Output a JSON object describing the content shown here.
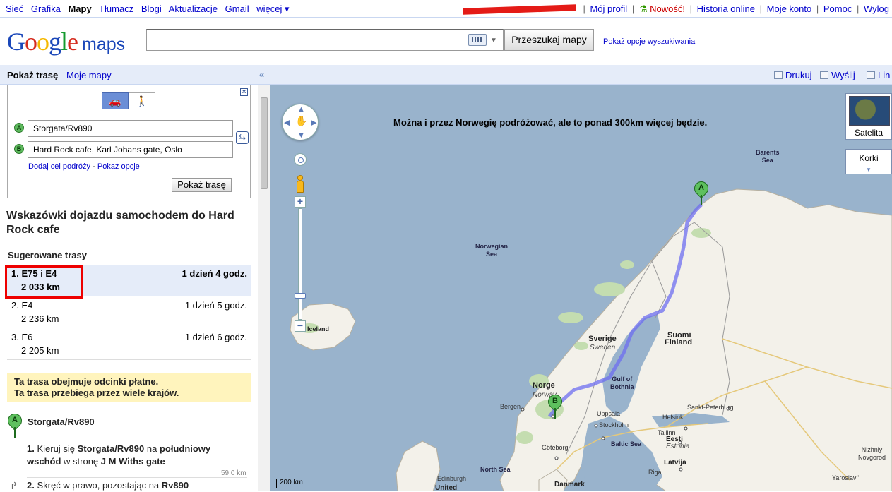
{
  "topbar": {
    "left_links": [
      "Sieć",
      "Grafika",
      "Mapy",
      "Tłumacz",
      "Blogi",
      "Aktualizacje",
      "Gmail",
      "więcej ▾"
    ],
    "active_index": 2,
    "right": {
      "profile": "Mój profil",
      "new": "Nowość!",
      "history": "Historia online",
      "account": "Moje konto",
      "help": "Pomoc",
      "logout": "Wylog"
    }
  },
  "header": {
    "logo_word": "Google",
    "logo_product": "maps",
    "search_value": "",
    "search_button": "Przeszukaj mapy",
    "search_options": "Pokaż opcje wyszukiwania"
  },
  "left_tabs": {
    "directions": "Pokaż trasę",
    "my_maps": "Moje mapy",
    "collapse": "«"
  },
  "directions_form": {
    "from_marker": "A",
    "from": "Storgata/Rv890",
    "to_marker": "B",
    "to": "Hard Rock cafe, Karl Johans gate, Oslo",
    "add_destination": "Dodaj cel podróży",
    "show_options": "Pokaż opcje",
    "submit": "Pokaż trasę"
  },
  "directions": {
    "title": "Wskazówki dojazdu samochodem do Hard Rock cafe",
    "suggested_title": "Sugerowane trasy",
    "routes": [
      {
        "name": "1. E75 i E4",
        "distance": "2 033 km",
        "time": "1 dzień 4 godz.",
        "selected": true
      },
      {
        "name": "2. E4",
        "distance": "2 236 km",
        "time": "1 dzień 5 godz.",
        "selected": false
      },
      {
        "name": "3. E6",
        "distance": "2 205 km",
        "time": "1 dzień 6 godz.",
        "selected": false
      }
    ],
    "notice_1": "Ta trasa obejmuje odcinki płatne.",
    "notice_2": "Ta trasa przebiega przez wiele krajów.",
    "start_marker": "A",
    "start": "Storgata/Rv890",
    "step1": {
      "num": "1.",
      "t1": "Kieruj się",
      "road": "Storgata/Rv890",
      "t2": "na",
      "dir": "południowy wschód",
      "t3": "w stronę",
      "toward": "J M Withs gate",
      "distance": "59,0 km"
    },
    "step2": {
      "num": "2.",
      "t1": "Skręć w prawo, pozostając na",
      "road": "Rv890"
    }
  },
  "map_toolbar": {
    "print": "Drukuj",
    "send": "Wyślij",
    "link": "Lin"
  },
  "map": {
    "message": "Można i przez Norwegię podróżować, ale to ponad 300km więcej będzie.",
    "map_types": {
      "satellite": "Satelita",
      "traffic": "Korki"
    },
    "markers": {
      "start": "A",
      "end": "B"
    },
    "scale": "200 km",
    "labels": {
      "barents": "Barents\nSea",
      "norwegian_sea": "Norwegian\nSea",
      "iceland": "Iceland",
      "sverige": "Sverige",
      "sweden": "Sweden",
      "suomi": "Suomi",
      "finland": "Finland",
      "norge": "Norge",
      "norway": "Norway",
      "gulf": "Gulf of\nBothnia",
      "bergen": "Bergen",
      "uppsala": "Uppsala",
      "stockholm": "Stockholm",
      "helsinki": "Helsinki",
      "spb": "Sankt-Peterburg",
      "tallinn": "Tallinn",
      "eesti": "Eesti",
      "estonia": "Estonia",
      "riga": "Riga",
      "latvija": "Latvija",
      "goteborg": "Göteborg",
      "baltic": "Baltic Sea",
      "north_sea": "North Sea",
      "danmark": "Danmark",
      "edinburgh": "Edinburgh",
      "united": "United",
      "nizhny": "Nizhniy\nNovgorod",
      "yaroslavl": "Yaroslavl'"
    }
  }
}
